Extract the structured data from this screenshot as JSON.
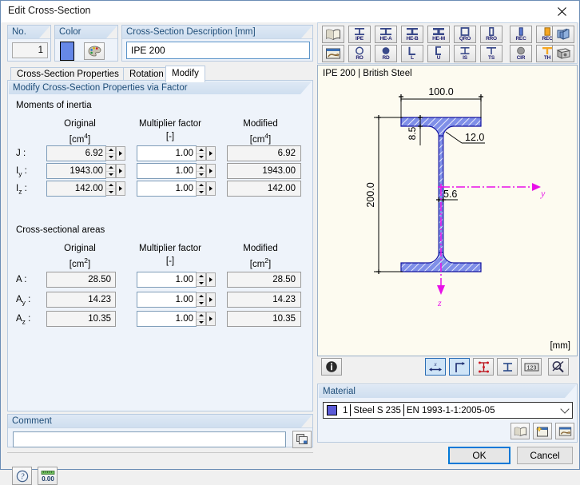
{
  "window": {
    "title": "Edit Cross-Section",
    "close_icon": "close-icon"
  },
  "header": {
    "no_label": "No.",
    "no_value": "1",
    "color_label": "Color",
    "color_value": "#6688e8",
    "color_button_icon": "palette-icon",
    "description_label": "Cross-Section Description [mm]",
    "description_value": "IPE 200"
  },
  "tabs": [
    {
      "label": "Cross-Section Properties",
      "active": false
    },
    {
      "label": "Rotation",
      "active": false
    },
    {
      "label": "Modify",
      "active": true
    }
  ],
  "panel": {
    "title": "Modify Cross-Section Properties via Factor",
    "sections": [
      {
        "name": "Moments of inertia",
        "columns": [
          "Original",
          "Multiplier factor",
          "Modified"
        ],
        "units": [
          "[cm⁴]",
          "[-]",
          "[cm⁴]"
        ],
        "rows": [
          {
            "label": "J",
            "original": "6.92",
            "factor": "1.00",
            "modified": "6.92"
          },
          {
            "label": "Iy",
            "original": "1943.00",
            "factor": "1.00",
            "modified": "1943.00"
          },
          {
            "label": "Iz",
            "original": "142.00",
            "factor": "1.00",
            "modified": "142.00"
          }
        ]
      },
      {
        "name": "Cross-sectional areas",
        "columns": [
          "Original",
          "Multiplier factor",
          "Modified"
        ],
        "units": [
          "[cm²]",
          "[-]",
          "[cm²]"
        ],
        "rows": [
          {
            "label": "A",
            "original": "28.50",
            "factor": "1.00",
            "modified": "28.50"
          },
          {
            "label": "Ay",
            "original": "14.23",
            "factor": "1.00",
            "modified": "14.23"
          },
          {
            "label": "Az",
            "original": "10.35",
            "factor": "1.00",
            "modified": "10.35"
          }
        ]
      }
    ]
  },
  "comment": {
    "label": "Comment",
    "value": "",
    "placeholder": "",
    "copy_icon": "copy-icon"
  },
  "footer": {
    "help_icon": "help-icon",
    "units_icon": "units-icon",
    "ok_label": "OK",
    "cancel_label": "Cancel"
  },
  "section_toolbar": {
    "row1": [
      {
        "name": "library-button",
        "icon": "book-icon",
        "label": ""
      },
      {
        "name": "ipe-button",
        "icon": "i-section-icon",
        "label": "IPE"
      },
      {
        "name": "hea-button",
        "icon": "i-section-icon",
        "label": "HE-A"
      },
      {
        "name": "heb-button",
        "icon": "i-section-icon",
        "label": "HE-B"
      },
      {
        "name": "hem-button",
        "icon": "i-section-icon",
        "label": "HE-M"
      },
      {
        "name": "qro-button",
        "icon": "square-hollow-icon",
        "label": "QRO"
      },
      {
        "name": "rro-button",
        "icon": "rect-hollow-icon",
        "label": "RRO"
      },
      {
        "name": "rec-solid-button",
        "icon": "rect-solid-icon",
        "label": "REC"
      },
      {
        "name": "rec-filled-button",
        "icon": "rect-filled-icon",
        "label": "REC"
      },
      {
        "name": "thin-walled-button",
        "icon": "thin-walled-icon",
        "label": ""
      }
    ],
    "row2": [
      {
        "name": "import-button",
        "icon": "import-icon",
        "label": ""
      },
      {
        "name": "ro-button",
        "icon": "circle-hollow-icon",
        "label": "RO"
      },
      {
        "name": "rd-button",
        "icon": "circle-filled-icon",
        "label": "RD"
      },
      {
        "name": "l-button",
        "icon": "l-section-icon",
        "label": "L"
      },
      {
        "name": "u-button",
        "icon": "u-section-icon",
        "label": "U"
      },
      {
        "name": "is-button",
        "icon": "is-section-icon",
        "label": "IS"
      },
      {
        "name": "ts-button",
        "icon": "ts-section-icon",
        "label": "TS"
      },
      {
        "name": "cir-button",
        "icon": "circle-gray-icon",
        "label": "CIR"
      },
      {
        "name": "th-button",
        "icon": "th-section-icon",
        "label": "TH"
      },
      {
        "name": "solid-block-button",
        "icon": "block-icon",
        "label": ""
      }
    ]
  },
  "viewer": {
    "caption": "IPE 200 | British Steel",
    "units": "[mm]",
    "axis_y_label": "y",
    "axis_z_label": "z",
    "dimensions": {
      "width": "100.0",
      "height": "200.0",
      "flange_thickness": "8.5",
      "web_thickness": "5.6",
      "root_radius": "12.0"
    }
  },
  "view_toolbar": {
    "info": {
      "name": "info-button",
      "icon": "info-icon"
    },
    "buttons": [
      {
        "name": "show-dimensions-button",
        "icon": "dimension-x-icon",
        "active": true
      },
      {
        "name": "show-axes-button",
        "icon": "axes-icon",
        "active": true
      },
      {
        "name": "show-stress-points-button",
        "icon": "stress-points-icon",
        "active": false
      },
      {
        "name": "show-parts-button",
        "icon": "parts-icon",
        "active": false
      },
      {
        "name": "show-numbering-button",
        "icon": "numbering-123-icon",
        "active": false
      },
      {
        "name": "zoom-reset-button",
        "icon": "zoom-off-icon",
        "active": false
      }
    ]
  },
  "material": {
    "label": "Material",
    "color": "#5b5bd6",
    "number": "1",
    "name": "Steel S 235",
    "standard": "EN 1993-1-1:2005-05",
    "buttons": [
      {
        "name": "material-library-button",
        "icon": "book-icon"
      },
      {
        "name": "material-new-button",
        "icon": "new-window-icon"
      },
      {
        "name": "material-import-button",
        "icon": "import-icon"
      }
    ]
  }
}
